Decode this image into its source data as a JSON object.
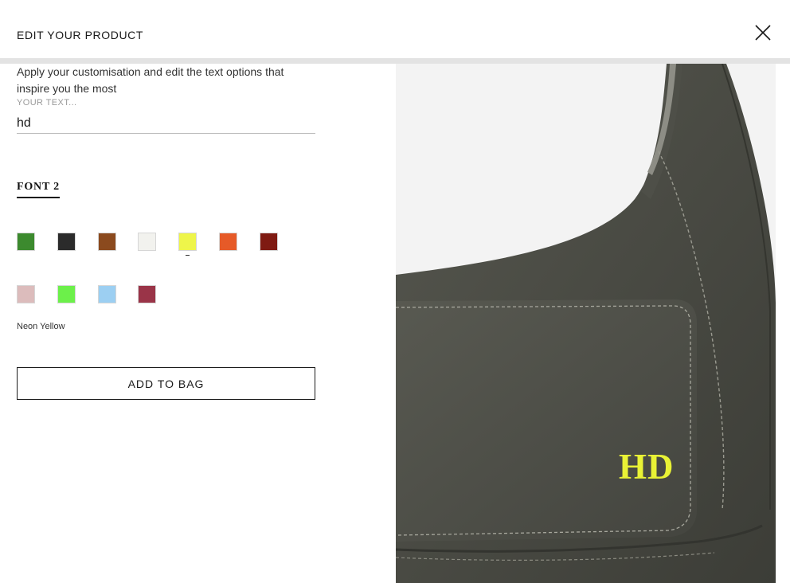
{
  "header": {
    "title": "EDIT YOUR PRODUCT",
    "close_icon": "close-icon"
  },
  "customise": {
    "description": "Apply your customisation and edit the text options that inspire you the most",
    "input_placeholder": "YOUR TEXT...",
    "input_value": "hd"
  },
  "font_tab": {
    "label": "FONT 2"
  },
  "colors": {
    "swatches": [
      "#3c8a2e",
      "#2b2b2b",
      "#8b4a1e",
      "#f2f2ee",
      "#eef54a",
      "#e65a28",
      "#7f1a12",
      "#dcbcbc",
      "#6cf04a",
      "#9ccff2",
      "#9a3448"
    ],
    "selected_index": 4,
    "selected_name": "Neon Yellow"
  },
  "actions": {
    "add_to_bag": "ADD TO BAG"
  },
  "preview": {
    "monogram_text": "HD",
    "monogram_color": "#e9f235",
    "bag_color": "#4a4b45"
  }
}
